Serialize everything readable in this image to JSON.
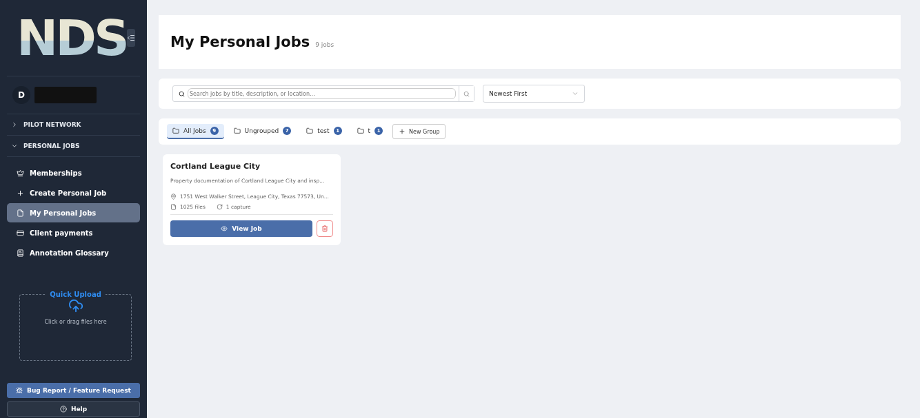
{
  "sidebar": {
    "logo": "NDS",
    "user": {
      "initial": "D"
    },
    "sections": [
      {
        "label": "PILOT NETWORK",
        "expanded": false
      },
      {
        "label": "PERSONAL JOBS",
        "expanded": true,
        "items": [
          {
            "label": "Memberships",
            "kind": "crown",
            "selected": false
          },
          {
            "label": "Create Personal Job",
            "kind": "plus",
            "selected": false
          },
          {
            "label": "My Personal Jobs",
            "kind": "file",
            "selected": true
          },
          {
            "label": "Client payments",
            "kind": "card",
            "selected": false
          },
          {
            "label": "Annotation Glossary",
            "kind": "book",
            "selected": false
          }
        ]
      }
    ],
    "quick_upload": {
      "title": "Quick Upload",
      "hint": "Click or drag files here"
    },
    "buttons": [
      {
        "label": "Bug Report / Feature Request",
        "kind": "primary"
      },
      {
        "label": "Help",
        "kind": "secondary"
      }
    ]
  },
  "header": {
    "title": "My Personal Jobs",
    "count": "9 jobs"
  },
  "search": {
    "placeholder": "Search jobs by title, description, or location..."
  },
  "sort": {
    "value": "Newest First"
  },
  "groups": [
    {
      "label": "All Jobs",
      "count": "9",
      "selected": true
    },
    {
      "label": "Ungrouped",
      "count": "7",
      "selected": false
    },
    {
      "label": "test",
      "count": "1",
      "selected": false
    },
    {
      "label": "t",
      "count": "1",
      "selected": false
    }
  ],
  "new_group": "New Group",
  "jobs": [
    {
      "title": "Cortland League City",
      "description": "Property documentation of Cortland League City and insp...",
      "address": "1751 West Walker Street, League City, Texas 77573, Un...",
      "files": "1025 files",
      "captures": "1 capture",
      "action": "View Job"
    }
  ]
}
